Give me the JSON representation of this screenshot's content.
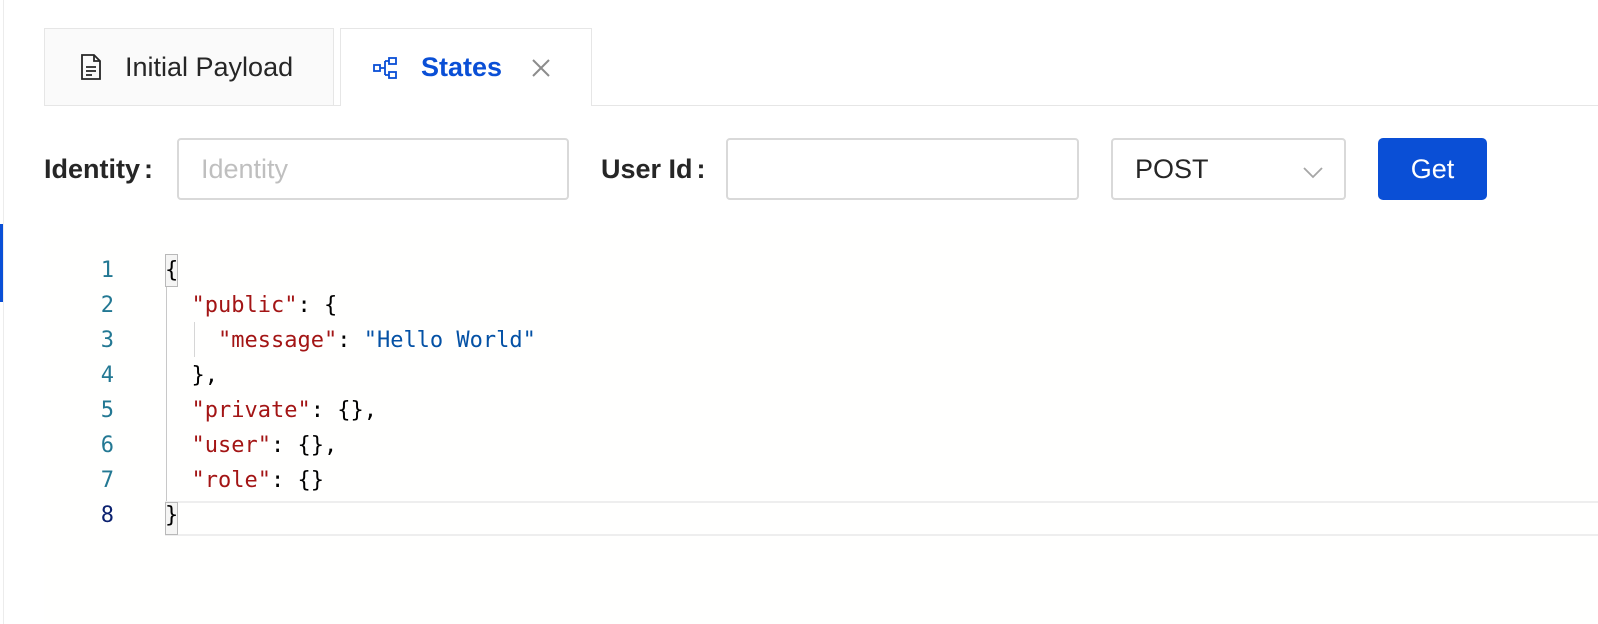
{
  "tabs": [
    {
      "label": "Initial Payload",
      "icon": "file-text-icon",
      "active": false
    },
    {
      "label": "States",
      "icon": "cluster-icon",
      "active": true,
      "close_icon": "close-icon"
    }
  ],
  "form": {
    "identity_label": "Identity",
    "identity_colon": ":",
    "identity_placeholder": "Identity",
    "identity_value": "",
    "userid_label": "User Id",
    "userid_colon": ":",
    "userid_value": "",
    "method_selected": "POST",
    "method_chevron_icon": "chevron-down-icon",
    "get_button_label": "Get"
  },
  "editor": {
    "line_numbers": [
      "1",
      "2",
      "3",
      "4",
      "5",
      "6",
      "7",
      "8"
    ],
    "active_line": 8,
    "lines": [
      {
        "parts": [
          {
            "t": "punct",
            "v": "{"
          }
        ]
      },
      {
        "parts": [
          {
            "t": "ws",
            "v": "  "
          },
          {
            "t": "key",
            "v": "\"public\""
          },
          {
            "t": "punct",
            "v": ": {"
          }
        ]
      },
      {
        "parts": [
          {
            "t": "ws",
            "v": "    "
          },
          {
            "t": "key",
            "v": "\"message\""
          },
          {
            "t": "punct",
            "v": ": "
          },
          {
            "t": "str",
            "v": "\"Hello World\""
          }
        ]
      },
      {
        "parts": [
          {
            "t": "ws",
            "v": "  "
          },
          {
            "t": "punct",
            "v": "},"
          }
        ]
      },
      {
        "parts": [
          {
            "t": "ws",
            "v": "  "
          },
          {
            "t": "key",
            "v": "\"private\""
          },
          {
            "t": "punct",
            "v": ": {},"
          }
        ]
      },
      {
        "parts": [
          {
            "t": "ws",
            "v": "  "
          },
          {
            "t": "key",
            "v": "\"user\""
          },
          {
            "t": "punct",
            "v": ": {},"
          }
        ]
      },
      {
        "parts": [
          {
            "t": "ws",
            "v": "  "
          },
          {
            "t": "key",
            "v": "\"role\""
          },
          {
            "t": "punct",
            "v": ": {}"
          }
        ]
      },
      {
        "parts": [
          {
            "t": "punct",
            "v": "}"
          }
        ]
      }
    ]
  },
  "colors": {
    "accent": "#0a4fd6",
    "json_key": "#a31515",
    "json_string": "#0451a5",
    "line_number": "#237893"
  }
}
